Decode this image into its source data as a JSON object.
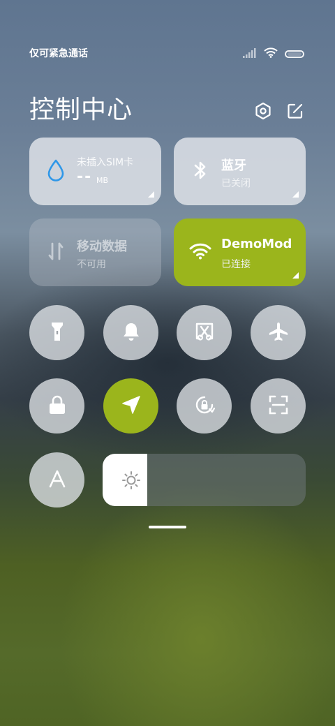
{
  "status_bar": {
    "carrier_text": "仅可紧急通话"
  },
  "header": {
    "title": "控制中心"
  },
  "tiles": {
    "data_usage": {
      "label": "未插入SIM卡",
      "value": "--",
      "unit": "MB"
    },
    "bluetooth": {
      "label": "蓝牙",
      "status": "已关闭"
    },
    "mobile_data": {
      "label": "移动数据",
      "status": "不可用"
    },
    "wifi": {
      "label": "DemoMode",
      "status": "已连接"
    }
  },
  "brightness": {
    "level": 0.22
  },
  "colors": {
    "accent": "#9bb51c",
    "water_drop": "#2e97e8"
  }
}
